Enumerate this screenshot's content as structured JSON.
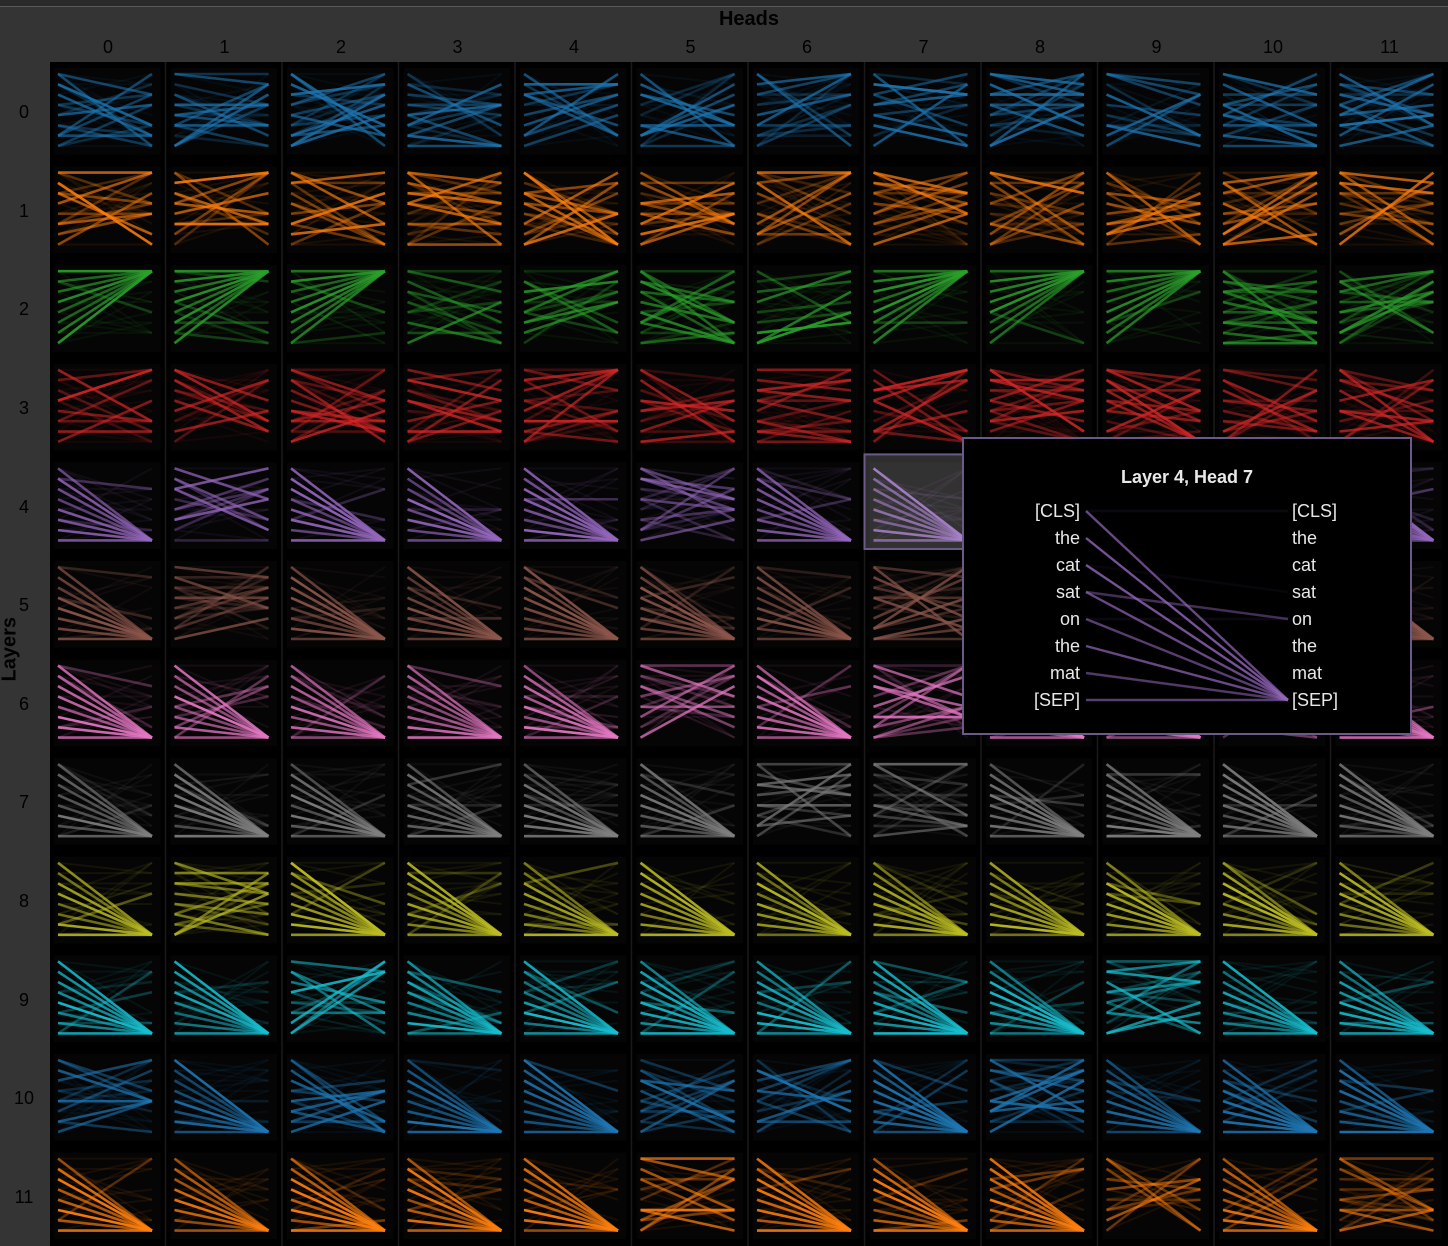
{
  "chart_data": {
    "type": "attention_grid",
    "title": "",
    "xlabel": "Heads",
    "ylabel": "Layers",
    "heads": [
      0,
      1,
      2,
      3,
      4,
      5,
      6,
      7,
      8,
      9,
      10,
      11
    ],
    "layers": [
      0,
      1,
      2,
      3,
      4,
      5,
      6,
      7,
      8,
      9,
      10,
      11
    ],
    "tokens": [
      "[CLS]",
      "the",
      "cat",
      "sat",
      "on",
      "the",
      "mat",
      "[SEP]"
    ],
    "layer_colors": [
      "#1f77b4",
      "#ff7f0e",
      "#2ca02c",
      "#d62728",
      "#9467bd",
      "#8c564b",
      "#e377c2",
      "#7f7f7f",
      "#bcbd22",
      "#17becf",
      "#1f77b4",
      "#ff7f0e"
    ],
    "highlighted": {
      "layer": 4,
      "head": 7
    }
  },
  "tooltip": {
    "title": "Layer 4, Head 7",
    "left_tokens": [
      "[CLS]",
      "the",
      "cat",
      "sat",
      "on",
      "the",
      "mat",
      "[SEP]"
    ],
    "right_tokens": [
      "[CLS]",
      "the",
      "cat",
      "sat",
      "on",
      "the",
      "mat",
      "[SEP]"
    ],
    "color": "#9467bd",
    "edges": [
      {
        "from": 0,
        "to": 7,
        "weight": 0.7
      },
      {
        "from": 1,
        "to": 7,
        "weight": 0.8
      },
      {
        "from": 2,
        "to": 7,
        "weight": 0.8
      },
      {
        "from": 3,
        "to": 7,
        "weight": 0.7
      },
      {
        "from": 3,
        "to": 4,
        "weight": 0.45
      },
      {
        "from": 4,
        "to": 7,
        "weight": 0.6
      },
      {
        "from": 5,
        "to": 7,
        "weight": 0.7
      },
      {
        "from": 6,
        "to": 7,
        "weight": 0.55
      },
      {
        "from": 7,
        "to": 7,
        "weight": 0.6
      },
      {
        "from": 0,
        "to": 0,
        "weight": 0.08
      },
      {
        "from": 2,
        "to": 3,
        "weight": 0.06
      },
      {
        "from": 4,
        "to": 4,
        "weight": 0.08
      }
    ]
  }
}
